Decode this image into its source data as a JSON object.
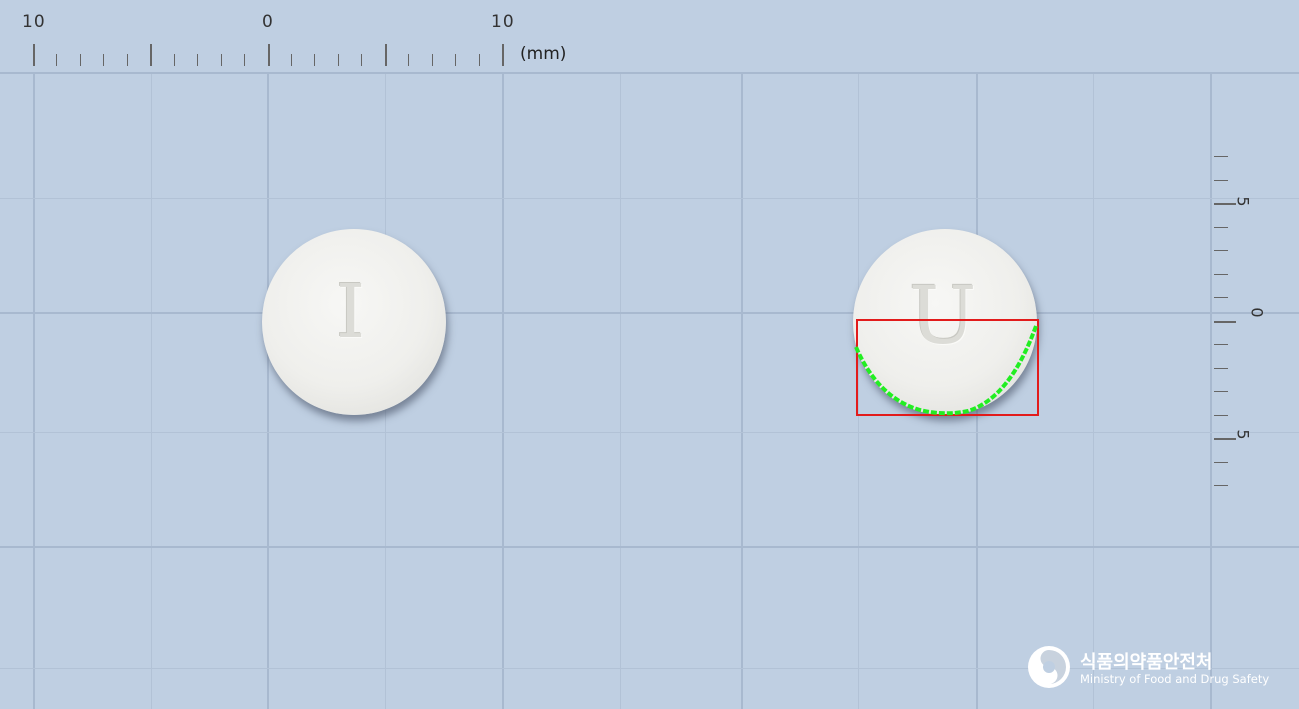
{
  "ruler_top": {
    "labels": [
      "10",
      "0",
      "10"
    ],
    "unit": "(mm)"
  },
  "ruler_right": {
    "labels": [
      "5",
      "0",
      "5"
    ]
  },
  "pills": [
    {
      "imprint": "I"
    },
    {
      "imprint": "U"
    }
  ],
  "colors": {
    "background": "#bfcfe2",
    "bbox": "#e21b1b",
    "contour": "#22ee22"
  },
  "logo": {
    "korean": "식품의약품안전처",
    "english": "Ministry of Food and Drug Safety"
  }
}
